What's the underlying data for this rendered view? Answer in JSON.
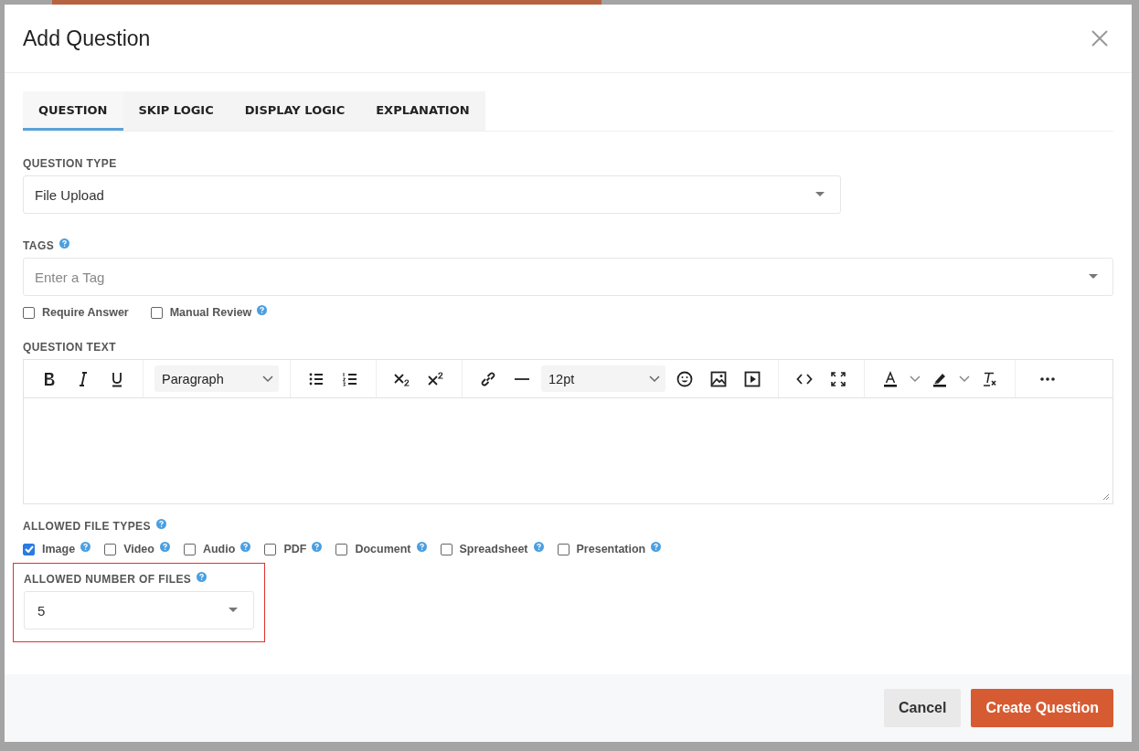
{
  "dialog": {
    "title": "Add Question"
  },
  "tabs": [
    {
      "label": "QUESTION",
      "selected": true
    },
    {
      "label": "SKIP LOGIC",
      "selected": false
    },
    {
      "label": "DISPLAY LOGIC",
      "selected": false
    },
    {
      "label": "EXPLANATION",
      "selected": false
    }
  ],
  "question_type": {
    "label": "QUESTION TYPE",
    "value": "File Upload"
  },
  "tags": {
    "label": "TAGS",
    "help": true,
    "placeholder": "Enter a Tag"
  },
  "options": [
    {
      "label": "Require Answer",
      "checked": false,
      "help": false
    },
    {
      "label": "Manual Review",
      "checked": false,
      "help": true
    }
  ],
  "question_text": {
    "label": "QUESTION TEXT",
    "block_format": "Paragraph",
    "font_size": "12pt"
  },
  "file_types": {
    "label": "ALLOWED FILE TYPES",
    "help": true,
    "items": [
      {
        "label": "Image",
        "checked": true,
        "help": true
      },
      {
        "label": "Video",
        "checked": false,
        "help": true
      },
      {
        "label": "Audio",
        "checked": false,
        "help": true
      },
      {
        "label": "PDF",
        "checked": false,
        "help": true
      },
      {
        "label": "Document",
        "checked": false,
        "help": true
      },
      {
        "label": "Spreadsheet",
        "checked": false,
        "help": true
      },
      {
        "label": "Presentation",
        "checked": false,
        "help": true
      }
    ]
  },
  "file_count": {
    "label": "ALLOWED NUMBER OF FILES",
    "help": true,
    "value": "5",
    "highlighted": true
  },
  "buttons": [
    {
      "label": "Cancel",
      "kind": "secondary"
    },
    {
      "label": "Create Question",
      "kind": "primary"
    }
  ]
}
